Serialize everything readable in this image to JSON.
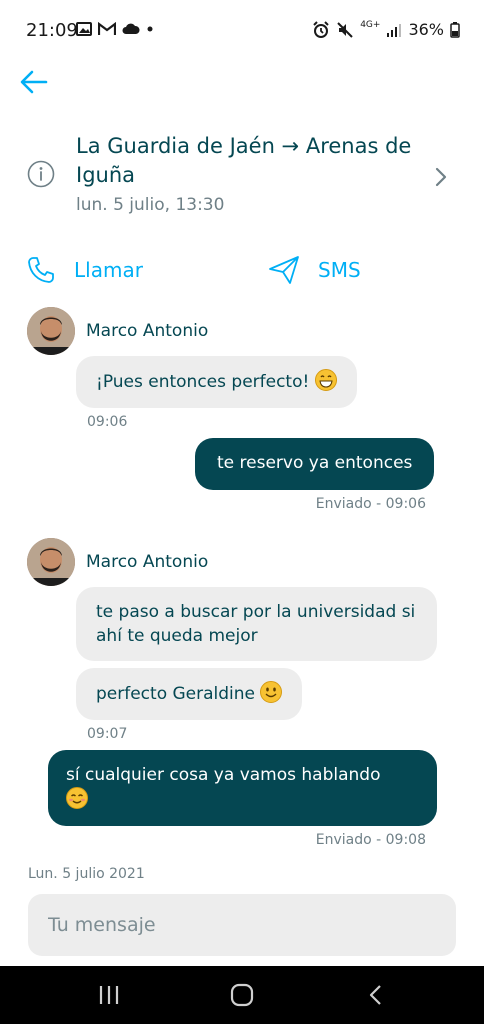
{
  "status_bar": {
    "time": "21:09",
    "battery": "36%",
    "network": "4G+"
  },
  "trip": {
    "route": "La Guardia de Jaén → Arenas de Iguña",
    "date": "lun. 5 julio, 13:30"
  },
  "actions": {
    "call_label": "Llamar",
    "sms_label": "SMS"
  },
  "messages": [
    {
      "direction": "in",
      "sender": "Marco Antonio",
      "text": "¡Pues entonces perfecto!",
      "emoji": "grin",
      "time": "09:06"
    },
    {
      "direction": "out",
      "text": "te reservo ya entonces",
      "status": "Enviado - 09:06"
    },
    {
      "direction": "in",
      "sender": "Marco Antonio",
      "text": "te paso a buscar por la universidad si ahí te queda mejor"
    },
    {
      "direction": "in",
      "text": "perfecto Geraldine",
      "emoji": "smile",
      "time": "09:07"
    },
    {
      "direction": "out",
      "text": "sí cualquier cosa ya vamos hablando",
      "emoji": "blush",
      "status": "Enviado - 09:08"
    }
  ],
  "day_label": "Lun. 5 julio 2021",
  "composer": {
    "placeholder": "Tu mensaje"
  },
  "colors": {
    "accent": "#00aff5",
    "brand_dark": "#054752",
    "bubble_in": "#ededed"
  }
}
